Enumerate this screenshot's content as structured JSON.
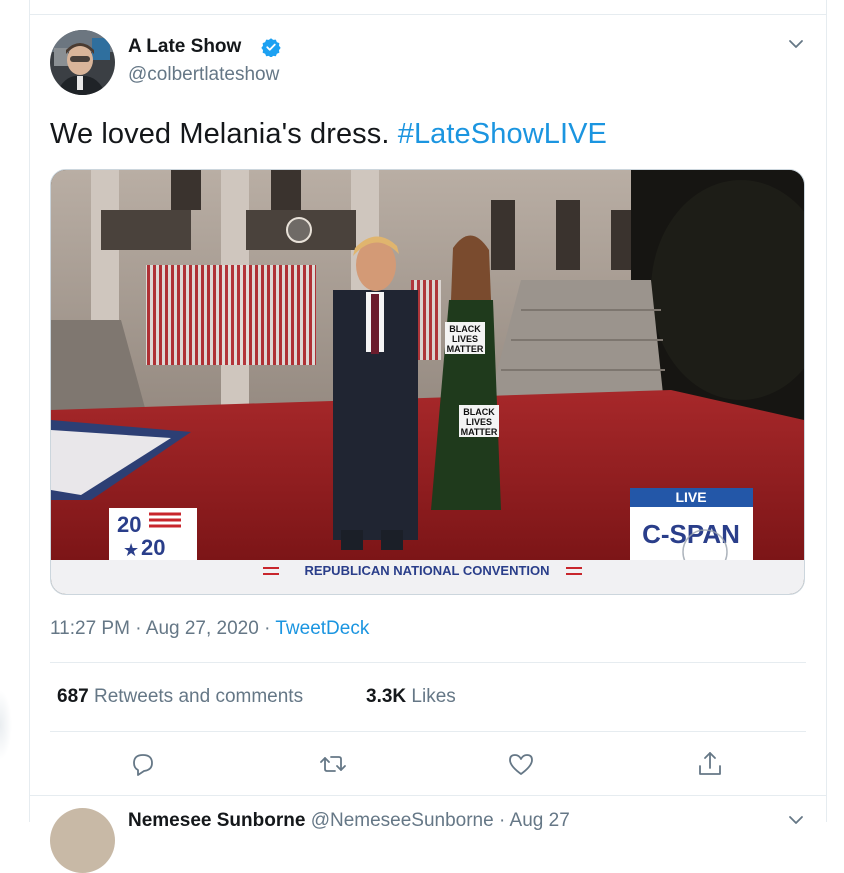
{
  "tweet": {
    "author_name": "A Late Show",
    "handle": "@colbertlateshow",
    "text_plain": "We loved Melania's dress.",
    "hashtag": "#LateShowLIVE",
    "time": "11:27 PM",
    "date": "Aug 27, 2020",
    "dot": "·",
    "source": "TweetDeck",
    "retweets_count": "687",
    "retweets_label": "Retweets and comments",
    "likes_count": "3.3K",
    "likes_label": "Likes"
  },
  "media": {
    "sign_lines": [
      "BLACK",
      "LIVES",
      "MATTER"
    ],
    "logo_2020_top": "20",
    "logo_2020_bottom": "20",
    "live_label": "LIVE",
    "network": "C-SPAN",
    "banner": "REPUBLICAN NATIONAL CONVENTION"
  },
  "next_tweet": {
    "author_name": "Nemesee Sunborne",
    "handle": "@NemeseeSunborne",
    "dot": "·",
    "date": "Aug 27"
  },
  "icons": {
    "verified": "verified-badge-icon",
    "more": "chevron-down-icon",
    "reply": "reply-icon",
    "retweet": "retweet-icon",
    "like": "heart-icon",
    "share": "share-icon"
  },
  "colors": {
    "link": "#1b95e0",
    "text": "#14171a",
    "secondary": "#657786",
    "border": "#e6ecf0",
    "live_blue": "#2357a8",
    "carpet_red": "#8e1d1f"
  }
}
